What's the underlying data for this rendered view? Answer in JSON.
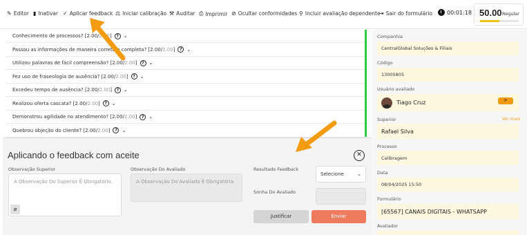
{
  "toolbar": {
    "items": [
      {
        "label": "Editor",
        "icon": "edit-icon"
      },
      {
        "label": "Inativar",
        "icon": "trash-icon"
      },
      {
        "label": "Aplicar feedback",
        "icon": "check-icon"
      },
      {
        "label": "Iniciar calibração",
        "icon": "scale-icon"
      },
      {
        "label": "Auditar",
        "icon": "gavel-icon"
      },
      {
        "label": "Imprimir",
        "icon": "print-icon"
      },
      {
        "label": "Ocultar conformidades",
        "icon": "eye-off-icon"
      },
      {
        "label": "Incluir avaliação dependente",
        "icon": "link-icon"
      },
      {
        "label": "Sair do formulário",
        "icon": "exit-icon"
      }
    ],
    "timer": "00:01:18",
    "score": {
      "value": "50.00",
      "label": "Regular",
      "progress": 0.5,
      "color": "#f1c40f"
    }
  },
  "questions": [
    {
      "text": "Conhecimento de processos?",
      "points": "[2.00/",
      "max": "2.00",
      "close": "]"
    },
    {
      "text": "Passou as informações de maneira correta e completa?",
      "points": "[2.00/",
      "max": "2.00",
      "close": "]"
    },
    {
      "text": "Utilizou palavras de fácil compreensão?",
      "points": "[2.00/",
      "max": "2.00",
      "close": "]"
    },
    {
      "text": "Fez uso de fraseologia de ausência?",
      "points": "[2.00/",
      "max": "2.00",
      "close": "]"
    },
    {
      "text": "Excedeu tempo de ausência?",
      "points": "[2.00/",
      "max": "2.00",
      "close": "]"
    },
    {
      "text": "Realizou oferta cascata?",
      "points": "[2.00/",
      "max": "2.00",
      "close": "]"
    },
    {
      "text": "Demonstrou agilidade no atendimento?",
      "points": "[2.00/",
      "max": "2.00",
      "close": "]"
    },
    {
      "text": "Quebrou objeção do cliente?",
      "points": "[2.00/",
      "max": "2.00",
      "close": "]"
    }
  ],
  "sidebar": {
    "companhia_label": "Companhia",
    "companhia": "CentralGlobal Soluções & Filiais",
    "codigo_label": "Código",
    "codigo": "13005805",
    "usuario_label": "Usuário avaliado",
    "usuario": "Tiago Cruz",
    "superior_label": "Superior",
    "ver_mais": "Ver mais",
    "superior": "Rafael Silva",
    "processo_label": "Processo",
    "processo": "Calibragem",
    "data_label": "Data",
    "data": "08/04/2025 15:50",
    "formulario_label": "Formulário",
    "formulario": "[65567] CANAIS DIGITAIS - WHATSAPP",
    "avaliador_label": "Avaliador"
  },
  "modal": {
    "title": "Aplicando o feedback com aceite",
    "obs_superior_label": "Observação Superior",
    "obs_superior_placeholder": "A Observação Do Superior É Obrigatório.",
    "obs_avaliado_label": "Observação Do Avaliado",
    "obs_avaliado_placeholder": "A Observação Do Avaliado É Obrigatória.",
    "resultado_label": "Resultado Feedback",
    "resultado_value": "Selecione",
    "sonha_label": "Sonha Do Avaliado",
    "justificar": "Justificar",
    "enviar": "Enviar"
  },
  "colors": {
    "accent": "#f39c12",
    "send": "#ee7b5e",
    "divider": "#2ecc40"
  }
}
